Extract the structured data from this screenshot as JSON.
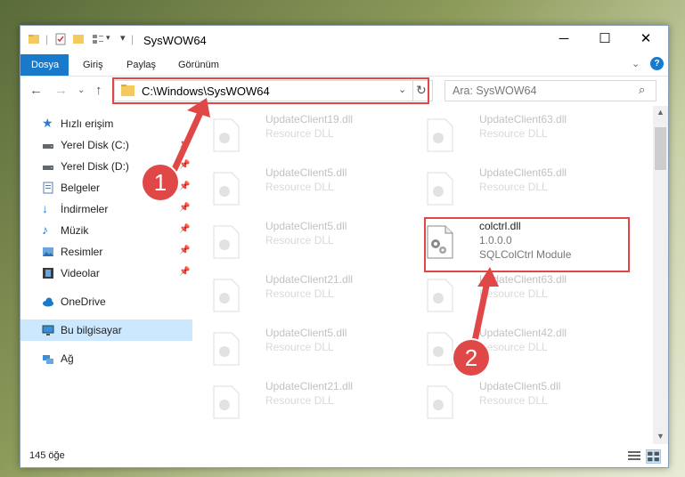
{
  "window": {
    "title": "SysWOW64",
    "controls": [
      "─",
      "☐",
      "✕"
    ]
  },
  "ribbon": {
    "tabs": [
      "Dosya",
      "Giriş",
      "Paylaş",
      "Görünüm"
    ]
  },
  "address": {
    "path": "C:\\Windows\\SysWOW64",
    "search_placeholder": "Ara: SysWOW64"
  },
  "sidebar": {
    "items": [
      {
        "label": "Hızlı erişim",
        "icon": "star-icon"
      },
      {
        "label": "Yerel Disk (C:)",
        "icon": "drive-icon"
      },
      {
        "label": "Yerel Disk (D:)",
        "icon": "drive-icon"
      },
      {
        "label": "Belgeler",
        "icon": "documents-icon"
      },
      {
        "label": "İndirmeler",
        "icon": "download-icon"
      },
      {
        "label": "Müzik",
        "icon": "music-icon"
      },
      {
        "label": "Resimler",
        "icon": "pictures-icon"
      },
      {
        "label": "Videolar",
        "icon": "video-icon"
      },
      {
        "label": "OneDrive",
        "icon": "cloud-icon"
      },
      {
        "label": "Bu bilgisayar",
        "icon": "computer-icon"
      },
      {
        "label": "Ağ",
        "icon": "network-icon"
      }
    ]
  },
  "files": {
    "left": [
      {
        "name": "UpdateClient19.dll",
        "desc": "Resource DLL"
      },
      {
        "name": "UpdateClient5.dll",
        "desc": "Resource DLL"
      },
      {
        "name": "UpdateClient5.dll",
        "desc": "Resource DLL"
      },
      {
        "name": "UpdateClient21.dll",
        "desc": "Resource DLL"
      },
      {
        "name": "UpdateClient5.dll",
        "desc": "Resource DLL"
      },
      {
        "name": "UpdateClient21.dll",
        "desc": "Resource DLL"
      }
    ],
    "right": [
      {
        "name": "UpdateClient63.dll",
        "desc": "Resource DLL"
      },
      {
        "name": "UpdateClient65.dll",
        "desc": "Resource DLL"
      },
      {
        "name": "UpdateClient63.dll",
        "desc": "Resource DLL"
      },
      {
        "name": "UpdateClient42.dll",
        "desc": "Resource DLL"
      },
      {
        "name": "UpdateClient5.dll",
        "desc": "Resource DLL"
      }
    ],
    "selected": {
      "name": "colctrl.dll",
      "version": "1.0.0.0",
      "desc": "SQLColCtrl Module"
    }
  },
  "status": {
    "count": "145 öğe"
  },
  "annotations": {
    "badge1": "1",
    "badge2": "2",
    "color": "#e04848"
  }
}
